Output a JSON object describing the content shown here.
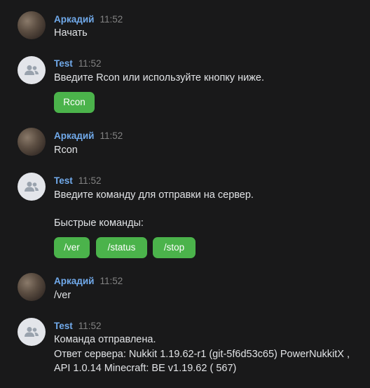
{
  "messages": [
    {
      "author": "Аркадий",
      "time": "11:52",
      "lines": [
        "Начать"
      ]
    },
    {
      "author": "Test",
      "time": "11:52",
      "lines": [
        "Введите Rcon или используйте кнопку ниже."
      ],
      "buttons": [
        "Rcon"
      ]
    },
    {
      "author": "Аркадий",
      "time": "11:52",
      "lines": [
        "Rcon"
      ]
    },
    {
      "author": "Test",
      "time": "11:52",
      "lines": [
        "Введите команду для отправки на сервер.",
        "",
        "Быстрые команды:"
      ],
      "buttons": [
        "/ver",
        "/status",
        "/stop"
      ]
    },
    {
      "author": "Аркадий",
      "time": "11:52",
      "lines": [
        "/ver"
      ]
    },
    {
      "author": "Test",
      "time": "11:52",
      "lines": [
        "Команда отправлена.",
        "Ответ сервера: Nukkit 1.19.62-r1 (git-5f6d53c65) PowerNukkitX ,",
        "API 1.0.14 Minecraft: BE v1.19.62 ( 567)"
      ]
    }
  ],
  "colors": {
    "background": "#19191a",
    "author_name": "#71aaeb",
    "button": "#4bb34b",
    "timestamp": "#828282"
  },
  "icons": {
    "bot_avatar": "users-icon",
    "user_avatar": "photo-avatar"
  }
}
